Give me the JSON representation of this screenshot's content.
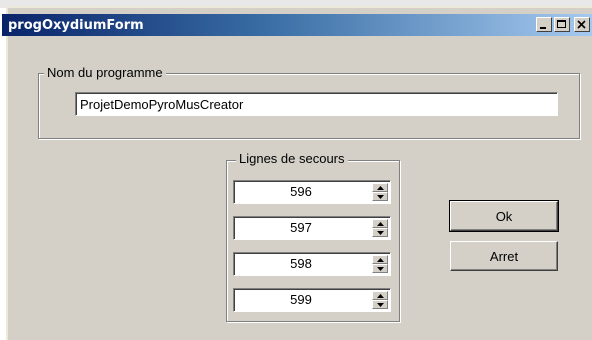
{
  "window": {
    "title": "progOxydiumForm",
    "controls": {
      "minimize_icon": "minimize-icon",
      "maximize_icon": "maximize-icon",
      "close_icon": "close-icon"
    }
  },
  "program_group": {
    "legend": "Nom du programme",
    "value": "ProjetDemoPyroMusCreator"
  },
  "backup_group": {
    "legend": "Lignes de secours",
    "lines": [
      "596",
      "597",
      "598",
      "599"
    ]
  },
  "buttons": {
    "ok_label": "Ok",
    "stop_label": "Arret"
  },
  "colors": {
    "window_bg": "#d4d0c8",
    "title_start": "#0a246a",
    "title_end": "#a6caf0"
  }
}
